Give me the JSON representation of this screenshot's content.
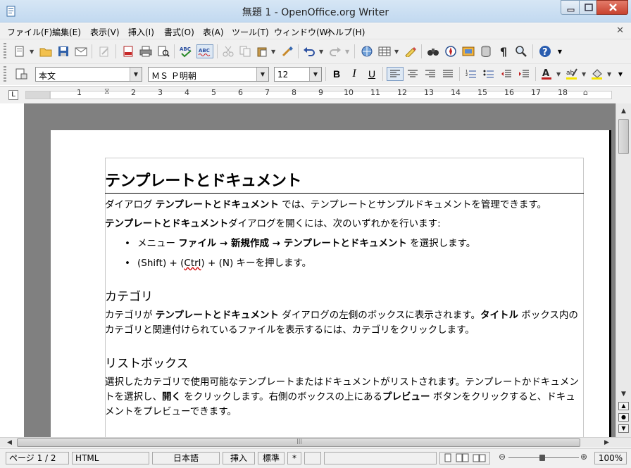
{
  "window": {
    "title": "無題 1 - OpenOffice.org Writer"
  },
  "menu": [
    "ファイル(F)",
    "編集(E)",
    "表示(V)",
    "挿入(I)",
    "書式(O)",
    "表(A)",
    "ツール(T)",
    "ウィンドウ(W)",
    "ヘルプ(H)"
  ],
  "formatting": {
    "paragraph_style": "本文",
    "font_name": "ＭＳ Ｐ明朝",
    "font_size": "12"
  },
  "ruler": {
    "ticks": [
      "1",
      "2",
      "3",
      "4",
      "5",
      "6",
      "7",
      "8",
      "9",
      "10",
      "11",
      "12",
      "13",
      "14",
      "15",
      "16",
      "17",
      "18"
    ]
  },
  "document": {
    "heading": "テンプレートとドキュメント",
    "p1_a": "ダイアログ ",
    "p1_b": "テンプレートとドキュメント",
    "p1_c": " では、テンプレートとサンプルドキュメントを管理できます。",
    "p2_b": "テンプレートとドキュメント",
    "p2_c": "ダイアログを開くには、次のいずれかを行います:",
    "li1_a": "メニュー ",
    "li1_b": "ファイル → 新規作成 → テンプレートとドキュメント",
    "li1_c": " を選択します。",
    "li2_a": "(Shift) + (",
    "li2_b": "Ctrl",
    "li2_c": ") + (N) キーを押します。",
    "h2_category": "カテゴリ",
    "p3_a": "カテゴリが ",
    "p3_b": "テンプレートとドキュメント",
    "p3_c": " ダイアログの左側のボックスに表示されます。",
    "p3_d": "タイトル",
    "p3_e": " ボックス内のカテゴリと関連付けられているファイルを表示するには、カテゴリをクリックします。",
    "h2_listbox": "リストボックス",
    "p4_a": "選択したカテゴリで使用可能なテンプレートまたはドキュメントがリストされます。テンプレートかドキュメントを選択し、",
    "p4_b": "開く",
    "p4_c": " をクリックします。右側のボックスの上にある",
    "p4_d": "プレビュー",
    "p4_e": " ボタンをクリックすると、ドキュメントをプレビューできます。"
  },
  "statusbar": {
    "page": "ページ 1 / 2",
    "style": "HTML",
    "language": "日本語",
    "insert_mode": "挿入",
    "selection_mode": "標準",
    "modified": "*",
    "zoom": "100%"
  },
  "colors": {
    "titlebar": "#c2d9f0",
    "doc_background": "#808080",
    "close_button": "#c8432f"
  }
}
